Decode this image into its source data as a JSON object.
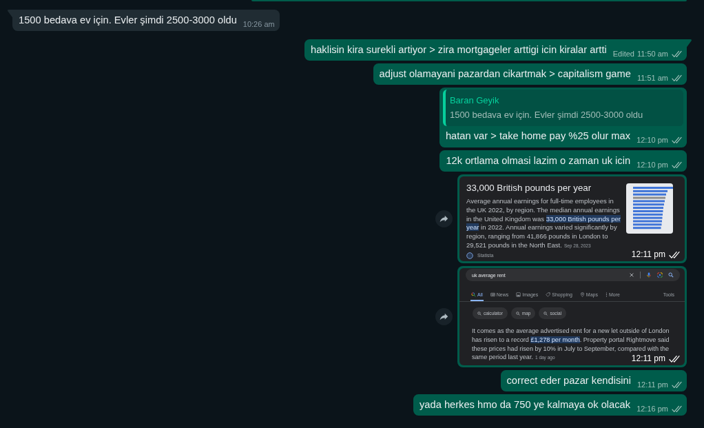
{
  "messages": [
    {
      "kind": "text",
      "outgoing": false,
      "tail": true,
      "text": "1500 bedava ev için. Evler şimdi 2500-3000 oldu",
      "time": "10:26 am"
    },
    {
      "kind": "text",
      "outgoing": true,
      "tail": true,
      "text": "haklisin kira surekli artiyor > zira mortgageler arttigi icin kiralar artti",
      "edited_label": "Edited",
      "time": "11:50 am",
      "read": false
    },
    {
      "kind": "text",
      "outgoing": true,
      "tail": false,
      "text": "adjust olamayani pazardan cikartmak > capitalism game",
      "time": "11:51 am",
      "read": false
    },
    {
      "kind": "reply",
      "outgoing": true,
      "tail": false,
      "quote": {
        "author": "Baran Geyik",
        "text": "1500 bedava ev için. Evler şimdi 2500-3000 oldu"
      },
      "text": "hatan var > take home pay %25 olur max",
      "time": "12:10 pm",
      "read": false
    },
    {
      "kind": "text",
      "outgoing": true,
      "tail": false,
      "text": "12k ortlama olmasi lazim o zaman uk icin",
      "time": "12:10 pm",
      "read": false
    },
    {
      "kind": "image",
      "outgoing": true,
      "tail": false,
      "forward_button": true,
      "time": "12:11 pm",
      "read": false,
      "screenshot": {
        "kind": "snippet",
        "title": "33,000 British pounds per year",
        "body": [
          {
            "text": "Average annual earnings for full-time employees in the UK 2022, by region. The median annual earnings in the United Kingdom was ",
            "highlighted": false
          },
          {
            "text": "33,000 British pounds per year",
            "highlighted": true
          },
          {
            "text": " in 2022. Annual earnings varied significantly by region, ranging from 41,866 pounds in London to 29,521 pounds in the North East.",
            "highlighted": false
          }
        ],
        "date": "Sep 28, 2023",
        "source": "Statista"
      }
    },
    {
      "kind": "image",
      "outgoing": true,
      "tail": false,
      "forward_button": true,
      "time": "12:11 pm",
      "read": false,
      "screenshot": {
        "kind": "search",
        "query": "uk average rent",
        "tabs": [
          {
            "kind": "all",
            "label": "All",
            "selected": true
          },
          {
            "kind": "news",
            "label": "News",
            "selected": false
          },
          {
            "kind": "images",
            "label": "Images",
            "selected": false
          },
          {
            "kind": "shopping",
            "label": "Shopping",
            "selected": false
          },
          {
            "kind": "maps",
            "label": "Maps",
            "selected": false
          },
          {
            "kind": "more",
            "label": "More",
            "selected": false
          }
        ],
        "tools_label": "Tools",
        "chips": [
          "calculator",
          "map",
          "social"
        ],
        "body": [
          {
            "text": "It comes as the average advertised rent for a new let outside of London has risen to a record ",
            "highlighted": false
          },
          {
            "text": "£1,278 per month",
            "highlighted": true
          },
          {
            "text": ". Property portal Rightmove said these prices had risen by 10% in July to September, compared with the same period last year.",
            "highlighted": false
          }
        ],
        "date": "1 day ago"
      }
    },
    {
      "kind": "text",
      "outgoing": true,
      "tail": false,
      "text": "correct eder pazar kendisini",
      "time": "12:11 pm",
      "read": false
    },
    {
      "kind": "text",
      "outgoing": true,
      "tail": false,
      "text": "yada herkes hmo da 750 ye kalmaya ok olacak",
      "time": "12:16 pm",
      "read": false
    }
  ]
}
